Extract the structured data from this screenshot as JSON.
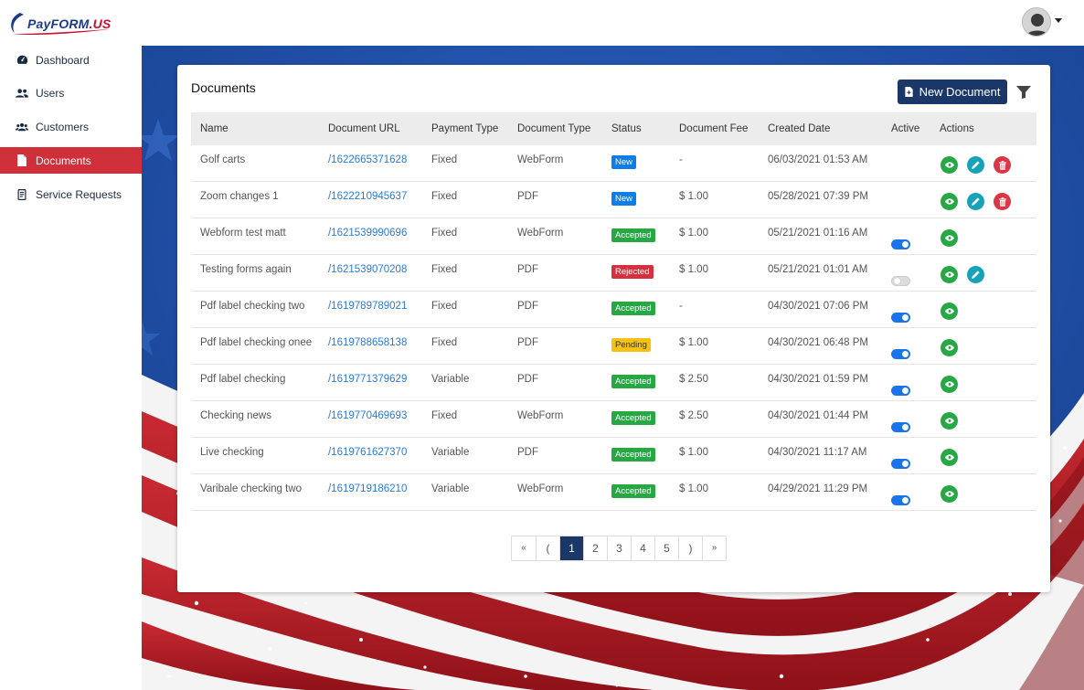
{
  "app": {
    "logo": {
      "name": "PayFORM",
      "suffix": ".US"
    }
  },
  "sidebar": {
    "items": [
      {
        "label": "Dashboard",
        "icon": "dashboard-icon",
        "active": false
      },
      {
        "label": "Users",
        "icon": "users-icon",
        "active": false
      },
      {
        "label": "Customers",
        "icon": "customers-icon",
        "active": false
      },
      {
        "label": "Documents",
        "icon": "document-icon",
        "active": true
      },
      {
        "label": "Service Requests",
        "icon": "service-requests-icon",
        "active": false
      }
    ]
  },
  "page": {
    "title": "Documents",
    "new_document_label": "New Document"
  },
  "table": {
    "headers": [
      "Name",
      "Document URL",
      "Payment Type",
      "Document Type",
      "Status",
      "Document Fee",
      "Created Date",
      "Active",
      "Actions"
    ],
    "rows": [
      {
        "name": "Golf carts",
        "url": "/1622665371628",
        "payment": "Fixed",
        "doctype": "WebForm",
        "status": "New",
        "fee": "-",
        "created": "06/03/2021 01:53 AM",
        "active": null,
        "actions": [
          "view",
          "edit",
          "delete"
        ]
      },
      {
        "name": "Zoom changes 1",
        "url": "/1622210945637",
        "payment": "Fixed",
        "doctype": "PDF",
        "status": "New",
        "fee": "$ 1.00",
        "created": "05/28/2021 07:39 PM",
        "active": null,
        "actions": [
          "view",
          "edit",
          "delete"
        ]
      },
      {
        "name": "Webform test matt",
        "url": "/1621539990696",
        "payment": "Fixed",
        "doctype": "WebForm",
        "status": "Accepted",
        "fee": "$ 1.00",
        "created": "05/21/2021 01:16 AM",
        "active": true,
        "actions": [
          "view"
        ]
      },
      {
        "name": "Testing forms again",
        "url": "/1621539070208",
        "payment": "Fixed",
        "doctype": "PDF",
        "status": "Rejected",
        "fee": "$ 1.00",
        "created": "05/21/2021 01:01 AM",
        "active": false,
        "actions": [
          "view",
          "edit"
        ]
      },
      {
        "name": "Pdf label checking two",
        "url": "/1619789789021",
        "payment": "Fixed",
        "doctype": "PDF",
        "status": "Accepted",
        "fee": "-",
        "created": "04/30/2021 07:06 PM",
        "active": true,
        "actions": [
          "view"
        ]
      },
      {
        "name": "Pdf label checking onee",
        "url": "/1619788658138",
        "payment": "Fixed",
        "doctype": "PDF",
        "status": "Pending",
        "fee": "$ 1.00",
        "created": "04/30/2021 06:48 PM",
        "active": true,
        "actions": [
          "view"
        ]
      },
      {
        "name": "Pdf label checking",
        "url": "/1619771379629",
        "payment": "Variable",
        "doctype": "PDF",
        "status": "Accepted",
        "fee": "$ 2.50",
        "created": "04/30/2021 01:59 PM",
        "active": true,
        "actions": [
          "view"
        ]
      },
      {
        "name": "Checking news",
        "url": "/1619770469693",
        "payment": "Fixed",
        "doctype": "WebForm",
        "status": "Accepted",
        "fee": "$ 2.50",
        "created": "04/30/2021 01:44 PM",
        "active": true,
        "actions": [
          "view"
        ]
      },
      {
        "name": "Live checking",
        "url": "/1619761627370",
        "payment": "Variable",
        "doctype": "PDF",
        "status": "Accepted",
        "fee": "$ 1.00",
        "created": "04/30/2021 11:17 AM",
        "active": true,
        "actions": [
          "view"
        ]
      },
      {
        "name": "Varibale checking two",
        "url": "/1619719186210",
        "payment": "Variable",
        "doctype": "WebForm",
        "status": "Accepted",
        "fee": "$ 1.00",
        "created": "04/29/2021 11:29 PM",
        "active": true,
        "actions": [
          "view"
        ]
      }
    ]
  },
  "pagination": {
    "first": "«",
    "prev": "(",
    "pages": [
      "1",
      "2",
      "3",
      "4",
      "5"
    ],
    "current": "1",
    "next": ")",
    "last": "»"
  },
  "colors": {
    "brand": "#1b3768",
    "active_nav": "#d0303a",
    "link": "#2a7bd6",
    "status_new": "#0d7de8",
    "status_accepted": "#28a745",
    "status_rejected": "#d62f3e",
    "status_pending": "#f5c211"
  }
}
